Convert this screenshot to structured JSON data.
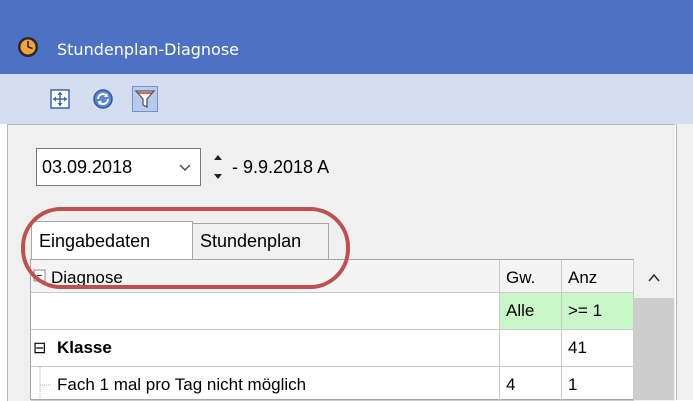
{
  "window": {
    "title": "Stundenplan-Diagnose",
    "icon": "clock-icon"
  },
  "toolbar": {
    "buttons": [
      {
        "icon": "move-grid-icon",
        "active": false
      },
      {
        "icon": "refresh-icon",
        "active": false
      },
      {
        "icon": "filter-icon",
        "active": true
      }
    ]
  },
  "date": {
    "value": "03.09.2018",
    "range": "- 9.9.2018 A"
  },
  "tabs": [
    {
      "label": "Eingabedaten",
      "active": true
    },
    {
      "label": "Stundenplan",
      "active": false
    }
  ],
  "table": {
    "headers": {
      "diagnose": "Diagnose",
      "gw": "Gw.",
      "anz": "Anz"
    },
    "filter_row": {
      "diagnose": "",
      "gw": "Alle",
      "anz": ">= 1"
    },
    "rows": [
      {
        "label": "Klasse",
        "gw": "",
        "anz": "41",
        "group": true,
        "expander": "⊟"
      },
      {
        "label": "Fach 1 mal pro Tag nicht möglich",
        "gw": "4",
        "anz": "1",
        "group": false
      }
    ]
  },
  "colors": {
    "titlebar": "#4d72c4",
    "toolbar": "#d5def0",
    "filter_cell": "#c9f7c9",
    "highlight": "#c0504d"
  }
}
